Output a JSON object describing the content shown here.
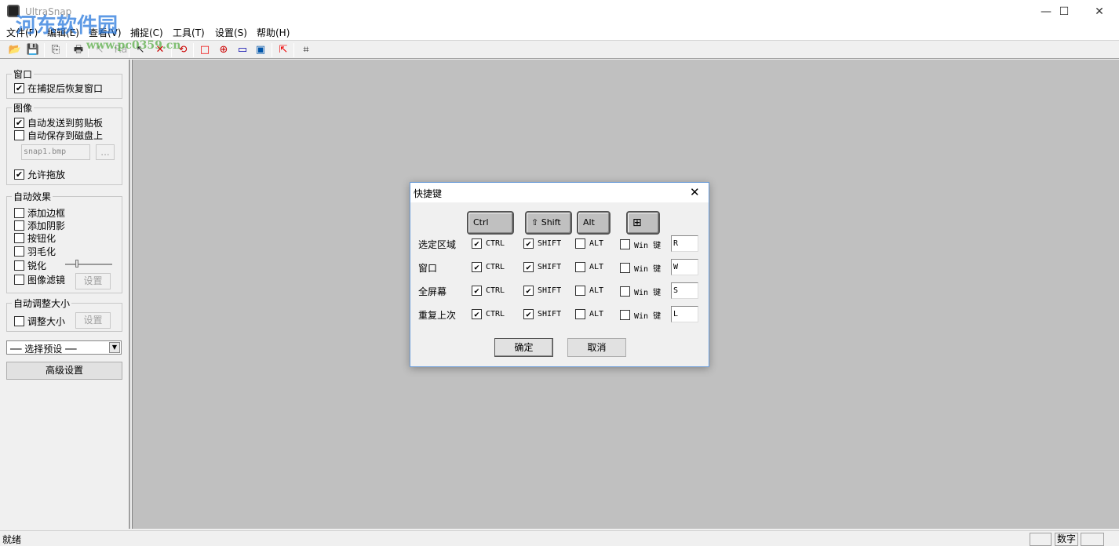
{
  "window": {
    "title": "UltraSnap",
    "watermark": "河东软件园",
    "watermark_url": "www.pc0359.cn",
    "controls": {
      "minimize": "—",
      "maximize": "☐",
      "close": "✕"
    }
  },
  "menu": [
    "文件(F)",
    "编辑(E)",
    "查看(V)",
    "捕捉(C)",
    "工具(T)",
    "设置(S)",
    "帮助(H)"
  ],
  "toolbar": [
    {
      "icon": "open-folder-icon",
      "glyph": "📂"
    },
    {
      "icon": "save-icon",
      "glyph": "💾"
    },
    {
      "icon": "copy-icon",
      "glyph": "⎘"
    },
    {
      "icon": "print-icon",
      "glyph": "🖶"
    },
    {
      "icon": "pointer-disabled-icon",
      "glyph": "↖"
    },
    {
      "icon": "text-disabled-icon",
      "glyph": "Ra"
    },
    {
      "icon": "select-pointer-icon",
      "glyph": "↖"
    },
    {
      "icon": "delete-pointer-icon",
      "glyph": "✕"
    },
    {
      "icon": "refresh-icon",
      "glyph": "⟲"
    },
    {
      "icon": "capture-region-icon",
      "glyph": "□"
    },
    {
      "icon": "zoom-capture-icon",
      "glyph": "⊕"
    },
    {
      "icon": "capture-window-icon",
      "glyph": "▭"
    },
    {
      "icon": "capture-fullscreen-icon",
      "glyph": "▣"
    },
    {
      "icon": "capture-repeat-icon",
      "glyph": "⇱"
    },
    {
      "icon": "crop-icon",
      "glyph": "⌗"
    }
  ],
  "sidebar": {
    "window_group": {
      "title": "窗口",
      "restore": {
        "label": "在捕捉后恢复窗口",
        "checked": true
      }
    },
    "image_group": {
      "title": "图像",
      "clipboard": {
        "label": "自动发送到剪贴板",
        "checked": true
      },
      "save_disk": {
        "label": "自动保存到磁盘上",
        "checked": false
      },
      "filename": "snap1.bmp",
      "browse": "...",
      "drag": {
        "label": "允许拖放",
        "checked": true
      }
    },
    "effects_group": {
      "title": "自动效果",
      "items": [
        {
          "label": "添加边框",
          "checked": false
        },
        {
          "label": "添加阴影",
          "checked": false
        },
        {
          "label": "按钮化",
          "checked": false
        },
        {
          "label": "羽毛化",
          "checked": false
        },
        {
          "label": "锐化",
          "checked": false
        },
        {
          "label": "图像滤镜",
          "checked": false
        }
      ],
      "sharpen_level": 0.25,
      "settings": "设置"
    },
    "resize_group": {
      "title": "自动调整大小",
      "resize": {
        "label": "调整大小",
        "checked": false
      },
      "settings": "设置"
    },
    "preset": "── 选择预设 ──",
    "advanced": "高级设置"
  },
  "status": {
    "text": "就绪",
    "num": "数字"
  },
  "dialog": {
    "title": "快捷键",
    "close": "✕",
    "keycaps": {
      "ctrl": "Ctrl",
      "shift": "⇧ Shift",
      "alt": "Alt",
      "win": "⊞"
    },
    "rows": [
      {
        "label": "选定区域",
        "ctrl": true,
        "shift": true,
        "alt": false,
        "win": false,
        "key": "R"
      },
      {
        "label": "窗口",
        "ctrl": true,
        "shift": true,
        "alt": false,
        "win": false,
        "key": "W"
      },
      {
        "label": "全屏幕",
        "ctrl": true,
        "shift": true,
        "alt": false,
        "win": false,
        "key": "S"
      },
      {
        "label": "重复上次",
        "ctrl": true,
        "shift": true,
        "alt": false,
        "win": false,
        "key": "L"
      }
    ],
    "mod_labels": {
      "ctrl": "CTRL",
      "shift": "SHIFT",
      "alt": "ALT",
      "win": "Win 键"
    },
    "ok": "确定",
    "cancel": "取消"
  }
}
